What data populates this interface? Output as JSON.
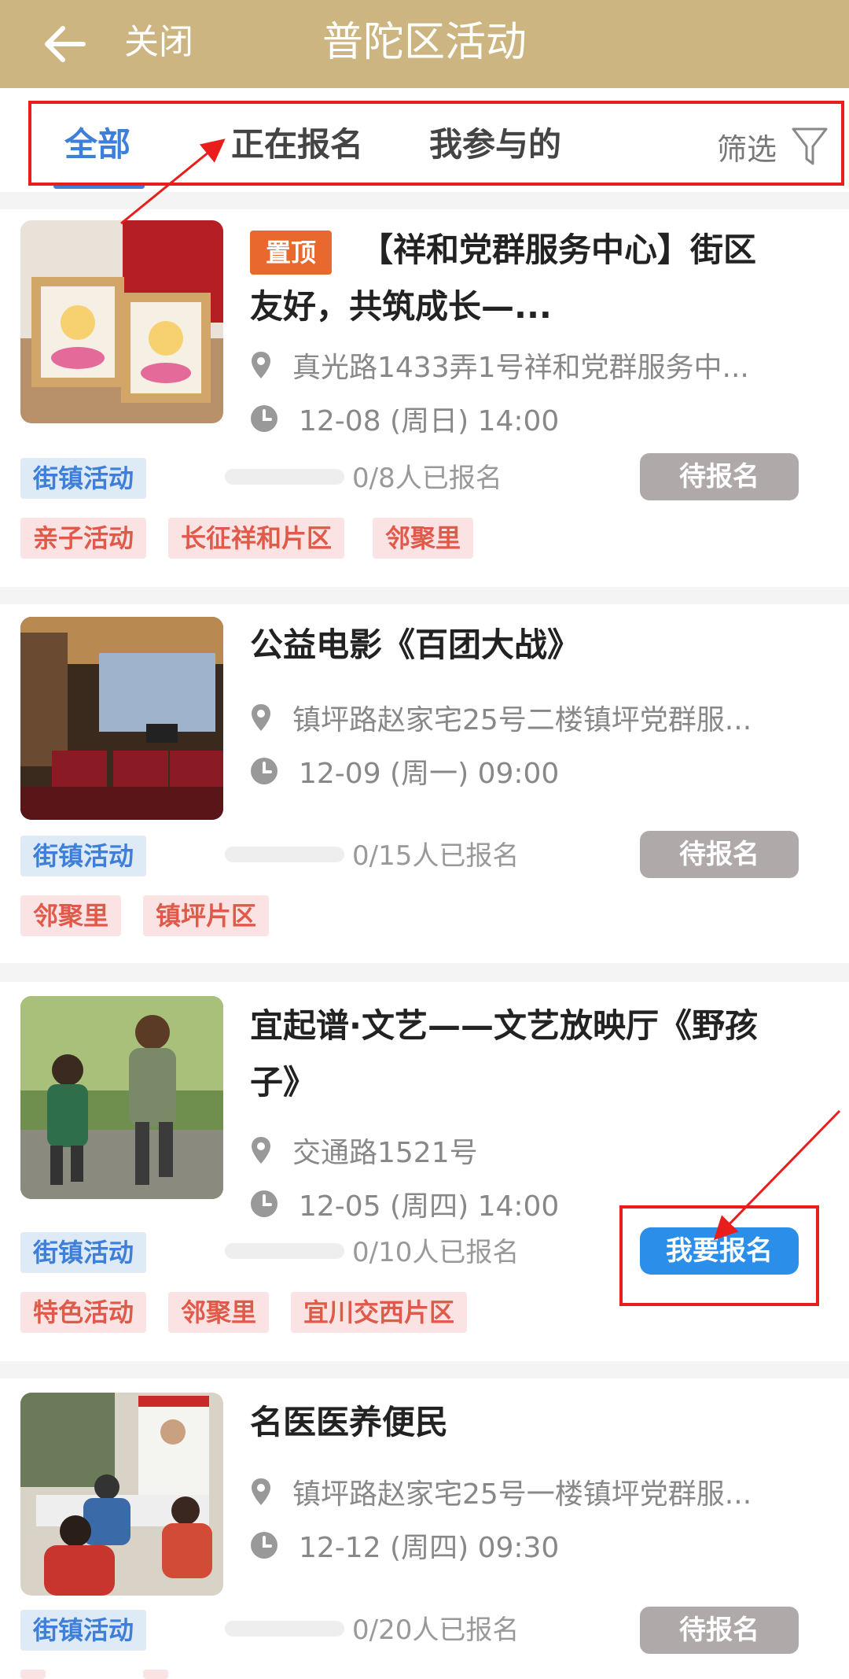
{
  "header": {
    "back_icon": "arrow-left-icon",
    "close_label": "关闭",
    "title": "普陀区活动",
    "bg_color": "#cdb582"
  },
  "tabs": {
    "items": [
      {
        "label": "全部",
        "active": true
      },
      {
        "label": "正在报名",
        "active": false
      },
      {
        "label": "我参与的",
        "active": false
      }
    ],
    "filter_label": "筛选",
    "filter_icon": "funnel-icon",
    "accent_color": "#3d7fd9"
  },
  "events": [
    {
      "pinned": true,
      "pin_label": "置顶",
      "title": "【祥和党群服务中心】街区友好，共筑成长—...",
      "address": "真光路1433弄1号祥和党群服务中...",
      "time": "12-08 (周日) 14:00",
      "category": "街镇活动",
      "signup": "0/8人已报名",
      "progress": 0,
      "status": "待报名",
      "tags": [
        "亲子活动",
        "长征祥和片区",
        "邻聚里"
      ]
    },
    {
      "pinned": false,
      "title": "公益电影《百团大战》",
      "address": "镇坪路赵家宅25号二楼镇坪党群服...",
      "time": "12-09 (周一) 09:00",
      "category": "街镇活动",
      "signup": "0/15人已报名",
      "progress": 0,
      "status": "待报名",
      "tags": [
        "邻聚里",
        "镇坪片区"
      ]
    },
    {
      "pinned": false,
      "title": "宜起谱·文艺——文艺放映厅《野孩子》",
      "address": "交通路1521号",
      "time": "12-05 (周四) 14:00",
      "category": "街镇活动",
      "signup": "0/10人已报名",
      "progress": 0,
      "status": "我要报名",
      "tags": [
        "特色活动",
        "邻聚里",
        "宜川交西片区"
      ]
    },
    {
      "pinned": false,
      "title": "名医医养便民",
      "address": "镇坪路赵家宅25号一楼镇坪党群服...",
      "time": "12-12 (周四) 09:30",
      "category": "街镇活动",
      "signup": "0/20人已报名",
      "progress": 0,
      "status": "待报名",
      "tags": []
    }
  ],
  "icons": {
    "location": "location-pin-icon",
    "time": "clock-icon"
  }
}
